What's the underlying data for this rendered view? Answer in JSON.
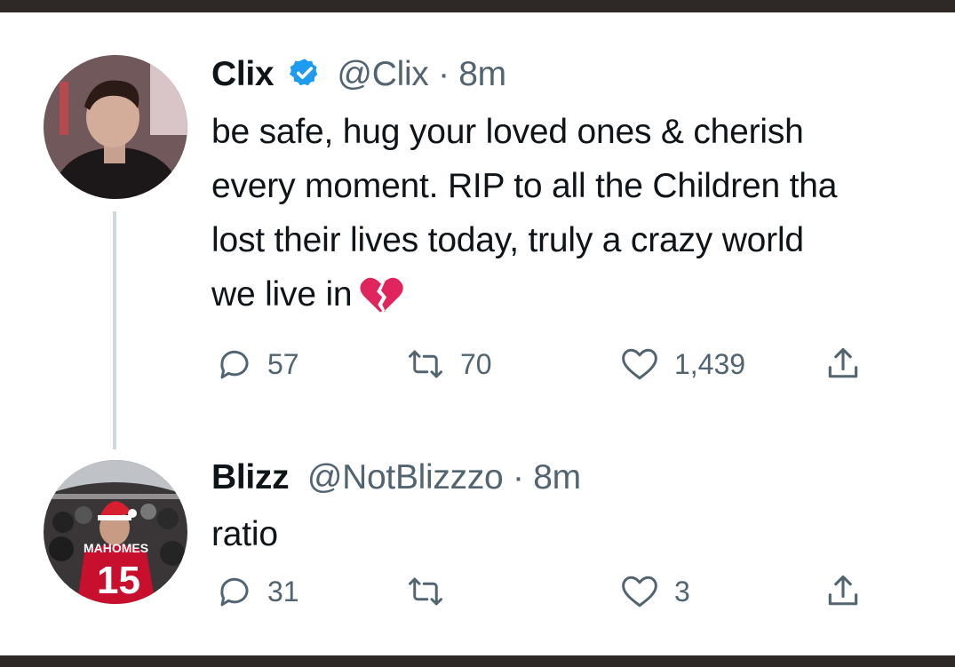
{
  "tweets": [
    {
      "name": "Clix",
      "verified": true,
      "handle": "@Clix",
      "separator": "·",
      "time": "8m",
      "text_lines": [
        "be safe, hug your loved ones & cherish",
        "every moment. RIP to all the Children tha",
        "lost their lives today, truly a crazy world",
        "we live in"
      ],
      "emoji": "broken-heart",
      "replies": "57",
      "retweets": "70",
      "likes": "1,439"
    },
    {
      "name": "Blizz",
      "verified": false,
      "handle": "@NotBlizzzo",
      "separator": "·",
      "time": "8m",
      "text_lines": [
        "ratio"
      ],
      "replies": "31",
      "retweets": "",
      "likes": "3",
      "avatar_jersey_text": "MAHOMES",
      "avatar_jersey_number": "15"
    }
  ],
  "colors": {
    "text": "#0f1419",
    "secondary": "#536471",
    "verified_badge": "#1d9bf0",
    "thread_line": "#cfd9de",
    "broken_heart": "#e0245e",
    "frame": "#2e2926"
  }
}
